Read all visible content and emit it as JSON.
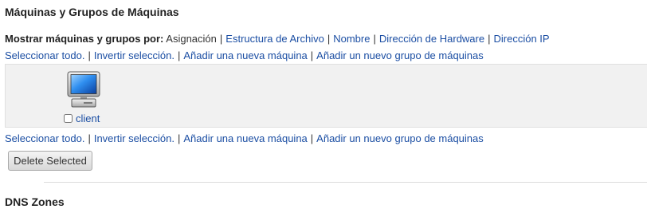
{
  "machines_section": {
    "title": "Máquinas y Grupos de Máquinas",
    "show_by": {
      "label": "Mostrar máquinas y grupos por:",
      "current": "Asignación",
      "options": [
        "Estructura de Archivo",
        "Nombre",
        "Dirección de Hardware",
        "Dirección IP"
      ]
    },
    "actions": {
      "select_all": "Seleccionar todo.",
      "invert": "Invertir selección.",
      "add_machine": "Añadir una nueva máquina",
      "add_group": "Añadir un nuevo grupo de máquinas"
    },
    "machines": [
      {
        "name": "client",
        "checked": false,
        "icon": "computer-monitor-icon"
      }
    ],
    "delete_button": "Delete Selected",
    "separator": "|"
  },
  "dns_section": {
    "title": "DNS Zones"
  },
  "colors": {
    "link": "#1b4ea3",
    "text": "#222222",
    "panel_background": "#f1f1f1"
  }
}
